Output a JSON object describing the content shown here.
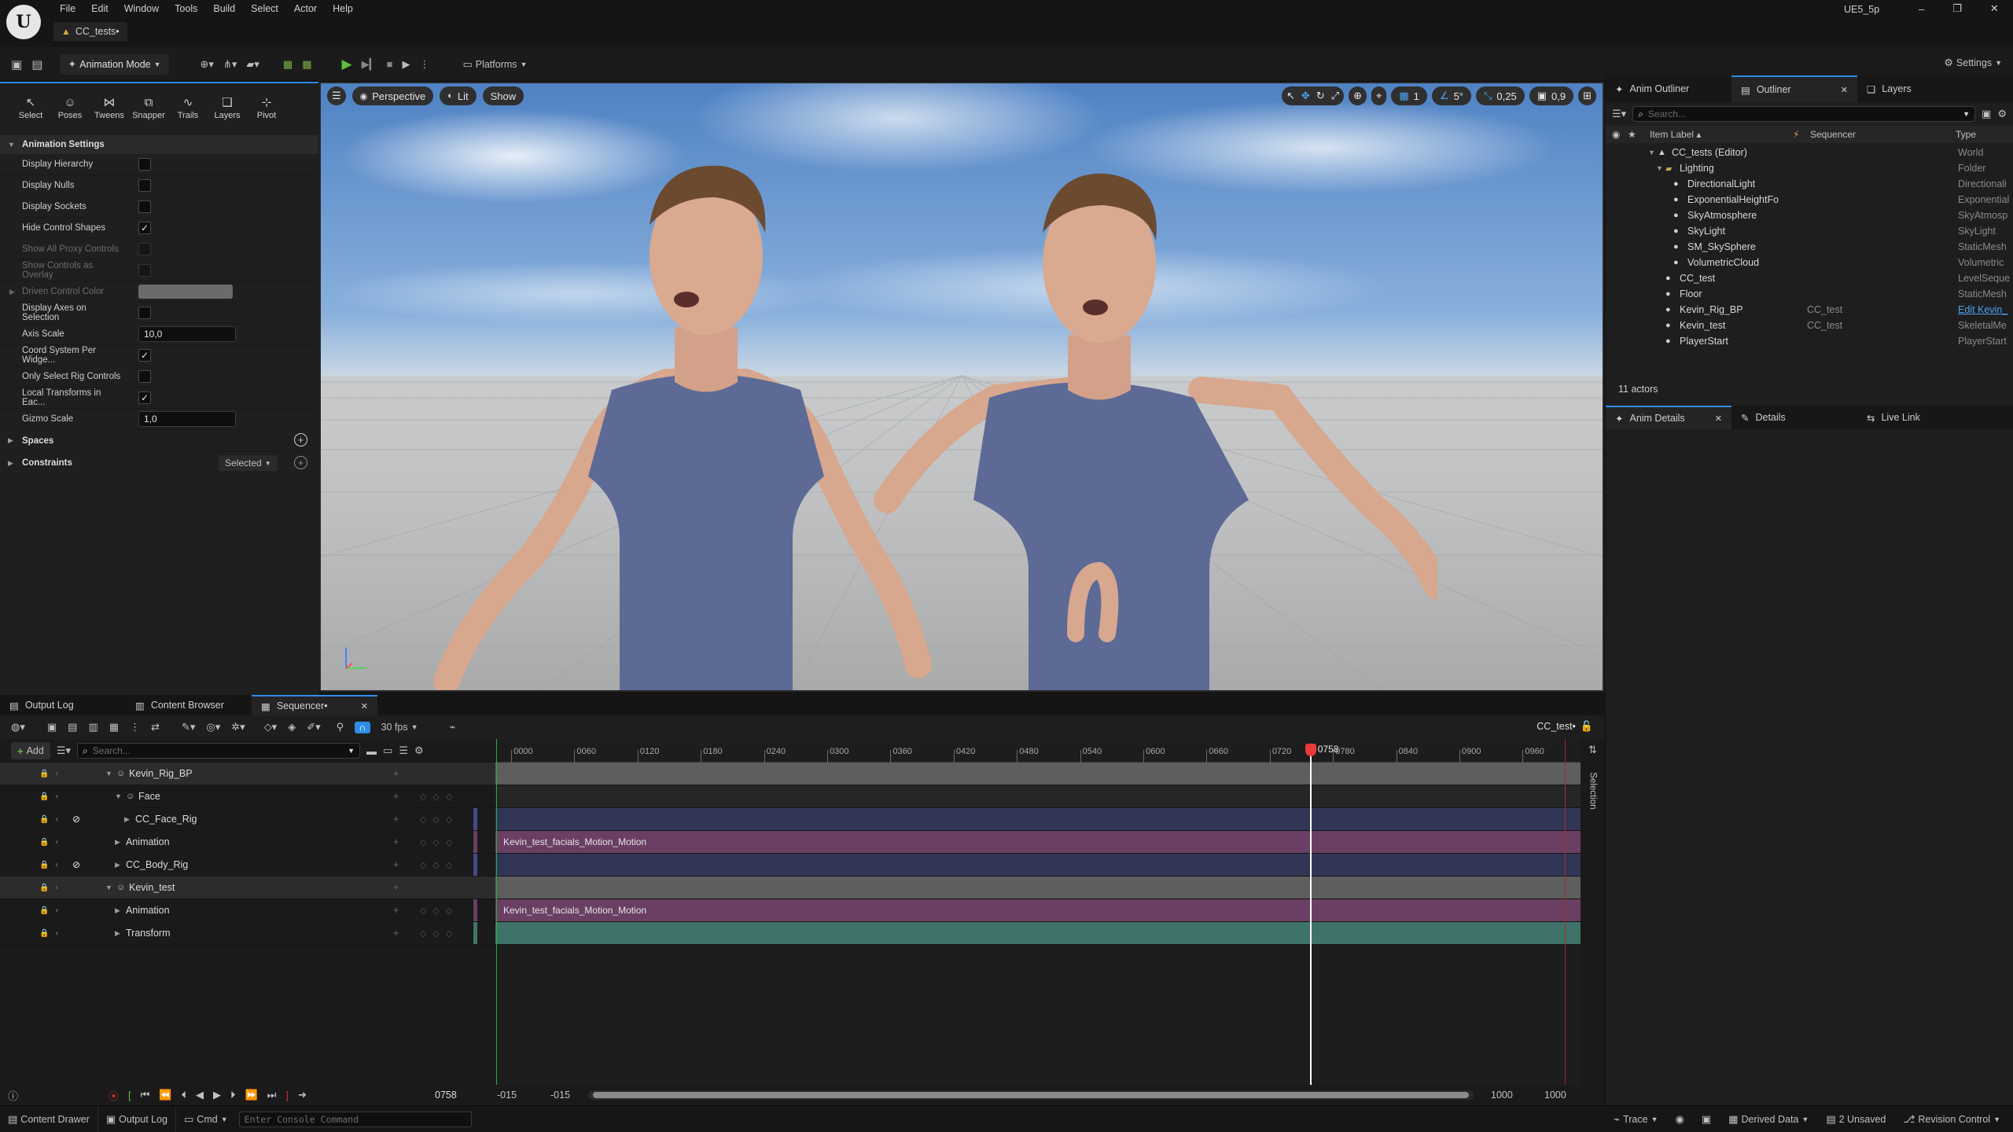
{
  "app": {
    "project": "UE5_5p",
    "tab_title": "CC_tests•"
  },
  "menu": [
    "File",
    "Edit",
    "Window",
    "Tools",
    "Build",
    "Select",
    "Actor",
    "Help"
  ],
  "toolbar": {
    "mode": "Animation Mode",
    "platforms": "Platforms",
    "settings": "Settings"
  },
  "anim_tools": [
    "Select",
    "Poses",
    "Tweens",
    "Snapper",
    "Trails",
    "Layers",
    "Pivot"
  ],
  "anim_settings": {
    "header": "Animation Settings",
    "rows": [
      {
        "label": "Display Hierarchy",
        "kind": "check",
        "checked": false,
        "dim": false
      },
      {
        "label": "Display Nulls",
        "kind": "check",
        "checked": false,
        "dim": false
      },
      {
        "label": "Display Sockets",
        "kind": "check",
        "checked": false,
        "dim": false
      },
      {
        "label": "Hide Control Shapes",
        "kind": "check",
        "checked": true,
        "dim": false
      },
      {
        "label": "Show All Proxy Controls",
        "kind": "check",
        "checked": false,
        "dim": true
      },
      {
        "label": "Show Controls as Overlay",
        "kind": "check",
        "checked": false,
        "dim": true
      },
      {
        "label": "Driven Control Color",
        "kind": "color",
        "dim": true
      },
      {
        "label": "Display Axes on Selection",
        "kind": "check",
        "checked": false,
        "dim": false
      },
      {
        "label": "Axis Scale",
        "kind": "number",
        "value": "10,0",
        "dim": false
      },
      {
        "label": "Coord System Per Widge...",
        "kind": "check",
        "checked": true,
        "dim": false
      },
      {
        "label": "Only Select Rig Controls",
        "kind": "check",
        "checked": false,
        "dim": false
      },
      {
        "label": "Local Transforms in Eac...",
        "kind": "check",
        "checked": true,
        "dim": false
      },
      {
        "label": "Gizmo Scale",
        "kind": "number",
        "value": "1,0",
        "dim": false
      }
    ],
    "spaces": "Spaces",
    "constraints": "Constraints",
    "constraints_value": "Selected"
  },
  "viewport": {
    "perspective": "Perspective",
    "lit": "Lit",
    "show": "Show",
    "snap_rot": "5°",
    "snap_scale": "0,25",
    "cam_speed": "0,9",
    "grid": "1"
  },
  "outliner": {
    "tabs": [
      "Anim Outliner",
      "Outliner",
      "Layers"
    ],
    "search_placeholder": "Search...",
    "col_label": "Item Label ▴",
    "col_seq": "Sequencer",
    "col_type": "Type",
    "rows": [
      {
        "name": "CC_tests (Editor)",
        "seq": "",
        "type": "World",
        "indent": 1,
        "arrow": "▼"
      },
      {
        "name": "Lighting",
        "seq": "",
        "type": "Folder",
        "indent": 2,
        "arrow": "▼"
      },
      {
        "name": "DirectionalLight",
        "seq": "",
        "type": "Directionali",
        "indent": 3,
        "arrow": ""
      },
      {
        "name": "ExponentialHeightFo",
        "seq": "",
        "type": "Exponential",
        "indent": 3,
        "arrow": ""
      },
      {
        "name": "SkyAtmosphere",
        "seq": "",
        "type": "SkyAtmosp",
        "indent": 3,
        "arrow": ""
      },
      {
        "name": "SkyLight",
        "seq": "",
        "type": "SkyLight",
        "indent": 3,
        "arrow": ""
      },
      {
        "name": "SM_SkySphere",
        "seq": "",
        "type": "StaticMesh",
        "indent": 3,
        "arrow": ""
      },
      {
        "name": "VolumetricCloud",
        "seq": "",
        "type": "Volumetric",
        "indent": 3,
        "arrow": ""
      },
      {
        "name": "CC_test",
        "seq": "",
        "type": "LevelSeque",
        "indent": 2,
        "arrow": ""
      },
      {
        "name": "Floor",
        "seq": "",
        "type": "StaticMesh",
        "indent": 2,
        "arrow": ""
      },
      {
        "name": "Kevin_Rig_BP",
        "seq": "CC_test",
        "type": "Edit Kevin_",
        "indent": 2,
        "arrow": ""
      },
      {
        "name": "Kevin_test",
        "seq": "CC_test",
        "type": "SkeletalMe",
        "indent": 2,
        "arrow": ""
      },
      {
        "name": "PlayerStart",
        "seq": "",
        "type": "PlayerStart",
        "indent": 2,
        "arrow": ""
      }
    ],
    "count": "11 actors"
  },
  "details_tabs": [
    "Anim Details",
    "Details",
    "Live Link"
  ],
  "bottom_tabs": [
    "Output Log",
    "Content Browser",
    "Sequencer•"
  ],
  "sequencer": {
    "fps": "30 fps",
    "name": "CC_test•",
    "add": "Add",
    "search_placeholder": "Search...",
    "playhead": "0758",
    "ruler": [
      "0000",
      "0060",
      "0120",
      "0180",
      "0240",
      "0300",
      "0360",
      "0420",
      "0480",
      "0540",
      "0600",
      "0660",
      "0720",
      "0780",
      "0840",
      "0900",
      "0960"
    ],
    "range_start_a": "-015",
    "range_start_b": "-015",
    "range_end_a": "1000",
    "range_end_b": "1000",
    "side_label": "Selection",
    "tracks": [
      {
        "name": "Kevin_Rig_BP",
        "indent": 0,
        "hdr": true,
        "bar": "gray",
        "clip": ""
      },
      {
        "name": "Face",
        "indent": 1,
        "hdr": false,
        "bar": "dark",
        "clip": ""
      },
      {
        "name": "CC_Face_Rig",
        "indent": 2,
        "hdr": false,
        "bar": "navy",
        "clip": ""
      },
      {
        "name": "Animation",
        "indent": 1,
        "hdr": false,
        "bar": "purple",
        "clip": "Kevin_test_facials_Motion_Motion"
      },
      {
        "name": "CC_Body_Rig",
        "indent": 1,
        "hdr": false,
        "bar": "navy",
        "clip": ""
      },
      {
        "name": "Kevin_test",
        "indent": 0,
        "hdr": true,
        "bar": "gray",
        "clip": ""
      },
      {
        "name": "Animation",
        "indent": 1,
        "hdr": false,
        "bar": "purple",
        "clip": "Kevin_test_facials_Motion_Motion"
      },
      {
        "name": "Transform",
        "indent": 1,
        "hdr": false,
        "bar": "teal",
        "clip": ""
      }
    ]
  },
  "statusbar": {
    "content_drawer": "Content Drawer",
    "output_log": "Output Log",
    "cmd": "Cmd",
    "console_placeholder": "Enter Console Command",
    "trace": "Trace",
    "derived": "Derived Data",
    "unsaved": "2 Unsaved",
    "revision": "Revision Control"
  },
  "colors": {
    "accent": "#2e8de8",
    "playhead": "#e83b3b",
    "clip_purple": "#6a3f63",
    "clip_teal": "#3f7369",
    "clip_navy": "#323656",
    "header_gray": "#5e5e5e"
  }
}
